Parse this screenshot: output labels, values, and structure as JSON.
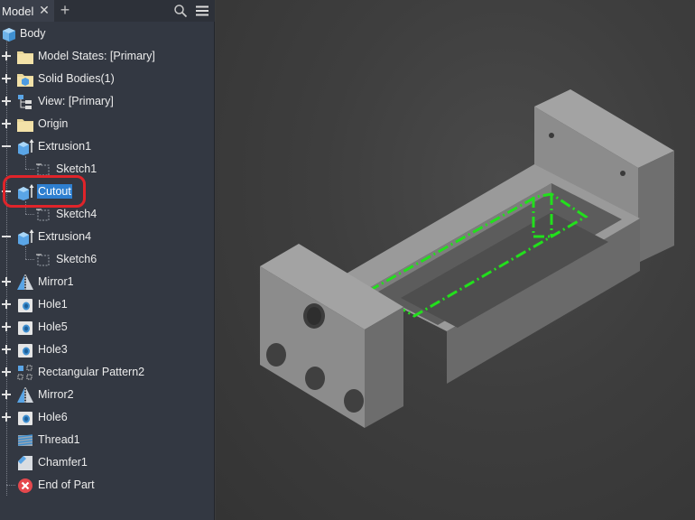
{
  "browser": {
    "tab_label": "Model",
    "close_glyph": "✕",
    "add_glyph": "+",
    "search_icon": "search-icon",
    "menu_icon": "hamburger-menu-icon"
  },
  "tree": {
    "items": [
      {
        "label": "Body",
        "icon": "part-body-icon",
        "expander": "none"
      },
      {
        "label": "Model States: [Primary]",
        "icon": "folder-icon",
        "expander": "plus"
      },
      {
        "label": "Solid Bodies(1)",
        "icon": "folder-solid-icon",
        "expander": "plus"
      },
      {
        "label": "View: [Primary]",
        "icon": "view-tree-icon",
        "expander": "plus"
      },
      {
        "label": "Origin",
        "icon": "folder-icon",
        "expander": "plus"
      },
      {
        "label": "Extrusion1",
        "icon": "extrusion-icon",
        "expander": "minus"
      },
      {
        "label": "Sketch1",
        "icon": "sketch-icon",
        "expander": "none"
      },
      {
        "label": "Cutout",
        "icon": "extrusion-icon",
        "expander": "minus",
        "selected": true
      },
      {
        "label": "Sketch4",
        "icon": "sketch-icon",
        "expander": "none"
      },
      {
        "label": "Extrusion4",
        "icon": "extrusion-icon",
        "expander": "minus"
      },
      {
        "label": "Sketch6",
        "icon": "sketch-icon",
        "expander": "none"
      },
      {
        "label": "Mirror1",
        "icon": "mirror-icon",
        "expander": "plus"
      },
      {
        "label": "Hole1",
        "icon": "hole-icon",
        "expander": "plus"
      },
      {
        "label": "Hole5",
        "icon": "hole-icon",
        "expander": "plus"
      },
      {
        "label": "Hole3",
        "icon": "hole-icon",
        "expander": "plus"
      },
      {
        "label": "Rectangular Pattern2",
        "icon": "rectangular-pattern-icon",
        "expander": "plus"
      },
      {
        "label": "Mirror2",
        "icon": "mirror-icon",
        "expander": "plus"
      },
      {
        "label": "Hole6",
        "icon": "hole-icon",
        "expander": "plus"
      },
      {
        "label": "Thread1",
        "icon": "thread-icon",
        "expander": "none"
      },
      {
        "label": "Chamfer1",
        "icon": "chamfer-icon",
        "expander": "none"
      },
      {
        "label": "End of Part",
        "icon": "end-of-part-icon",
        "expander": "none"
      }
    ]
  },
  "colors": {
    "panel_bg": "#333842",
    "selection": "#2e7fd0",
    "callout": "#e0242a",
    "sketch_highlight": "#22e01c",
    "model_face": "#8a8a8a"
  },
  "viewport": {
    "model": "3d-part-model",
    "highlighted_feature": "Cutout"
  }
}
